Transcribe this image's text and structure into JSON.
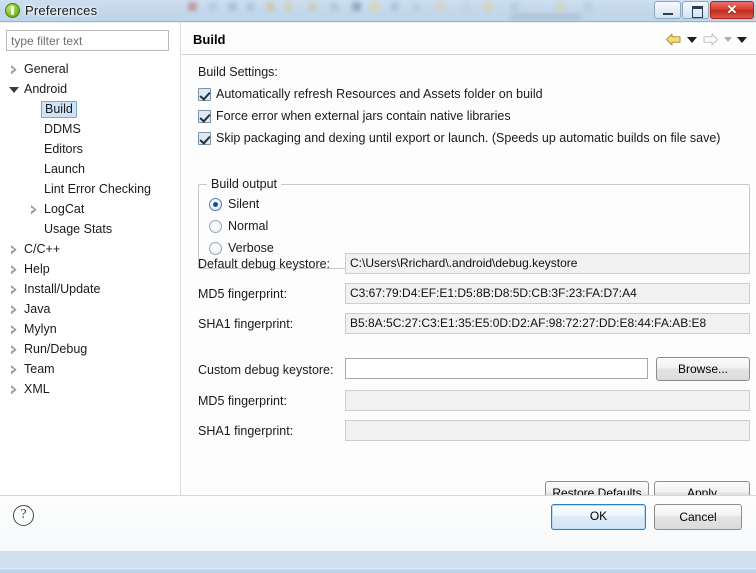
{
  "window": {
    "title": "Preferences",
    "icon": "preferences-app-icon",
    "controls": {
      "minimize": "minimize-button",
      "maximize": "maximize-button",
      "close": "✕"
    }
  },
  "sidebar": {
    "filter": {
      "value": "",
      "placeholder": "type filter text"
    },
    "items": [
      {
        "label": "General",
        "indent": 0,
        "state": "collapsed",
        "selected": false
      },
      {
        "label": "Android",
        "indent": 0,
        "state": "expanded",
        "selected": false
      },
      {
        "label": "Build",
        "indent": 1,
        "state": "leaf",
        "selected": true
      },
      {
        "label": "DDMS",
        "indent": 1,
        "state": "leaf",
        "selected": false
      },
      {
        "label": "Editors",
        "indent": 1,
        "state": "leaf",
        "selected": false
      },
      {
        "label": "Launch",
        "indent": 1,
        "state": "leaf",
        "selected": false
      },
      {
        "label": "Lint Error Checking",
        "indent": 1,
        "state": "leaf",
        "selected": false
      },
      {
        "label": "LogCat",
        "indent": 1,
        "state": "collapsed",
        "selected": false
      },
      {
        "label": "Usage Stats",
        "indent": 1,
        "state": "leaf",
        "selected": false
      },
      {
        "label": "C/C++",
        "indent": 0,
        "state": "collapsed",
        "selected": false
      },
      {
        "label": "Help",
        "indent": 0,
        "state": "collapsed",
        "selected": false
      },
      {
        "label": "Install/Update",
        "indent": 0,
        "state": "collapsed",
        "selected": false
      },
      {
        "label": "Java",
        "indent": 0,
        "state": "collapsed",
        "selected": false
      },
      {
        "label": "Mylyn",
        "indent": 0,
        "state": "collapsed",
        "selected": false
      },
      {
        "label": "Run/Debug",
        "indent": 0,
        "state": "collapsed",
        "selected": false
      },
      {
        "label": "Team",
        "indent": 0,
        "state": "collapsed",
        "selected": false
      },
      {
        "label": "XML",
        "indent": 0,
        "state": "collapsed",
        "selected": false
      }
    ]
  },
  "page": {
    "title": "Build",
    "nav": {
      "back_icon": "back-arrow-icon",
      "back_menu_icon": "chevron-down-icon",
      "forward_icon": "forward-arrow-icon",
      "forward_menu_icon": "chevron-down-icon",
      "view_menu_icon": "chevron-down-icon"
    },
    "settings_label": "Build Settings:",
    "checkboxes": [
      {
        "label": "Automatically refresh Resources and Assets folder on build",
        "checked": true
      },
      {
        "label": "Force error when external jars contain native libraries",
        "checked": true
      },
      {
        "label": "Skip packaging and dexing until export or launch. (Speeds up automatic builds on file save)",
        "checked": true
      }
    ],
    "build_output": {
      "legend": "Build output",
      "options": [
        {
          "label": "Silent",
          "selected": true
        },
        {
          "label": "Normal",
          "selected": false
        },
        {
          "label": "Verbose",
          "selected": false
        }
      ]
    },
    "fields": [
      {
        "label": "Default debug keystore:",
        "value": "C:\\Users\\Rrichard\\.android\\debug.keystore",
        "readonly": true
      },
      {
        "label": "MD5 fingerprint:",
        "value": "C3:67:79:D4:EF:E1:D5:8B:D8:5D:CB:3F:23:FA:D7:A4",
        "readonly": true
      },
      {
        "label": "SHA1 fingerprint:",
        "value": "B5:8A:5C:27:C3:E1:35:E5:0D:D2:AF:98:72:27:DD:E8:44:FA:AB:E8",
        "readonly": true
      },
      {
        "label": "Custom debug keystore:",
        "value": "",
        "readonly": false
      },
      {
        "label": "MD5 fingerprint:",
        "value": "",
        "readonly": true
      },
      {
        "label": "SHA1 fingerprint:",
        "value": "",
        "readonly": true
      }
    ],
    "browse_label": "Browse...",
    "restore_defaults_label": "Restore Defaults",
    "apply_label": "Apply"
  },
  "footer": {
    "help_icon": "?",
    "ok_label": "OK",
    "cancel_label": "Cancel"
  },
  "colors": {
    "selection_blue": "#cfe3f7",
    "focus_blue": "#2f7fc1",
    "close_red": "#d93b2e",
    "accent_green": "#8dc63f"
  }
}
